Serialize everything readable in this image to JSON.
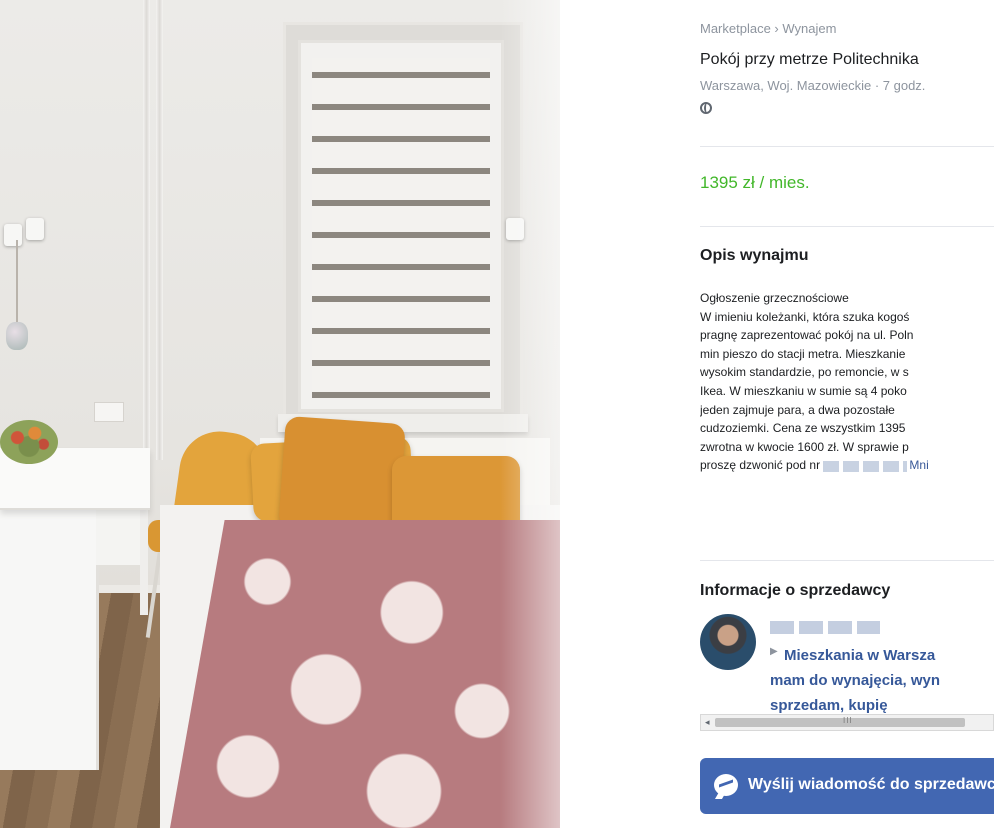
{
  "listing": {
    "breadcrumb": "Marketplace › Wynajem",
    "title": "Pokój przy metrze Politechnika",
    "location": "Warszawa, Woj. Mazowieckie · 7 godz.",
    "price": "1395 zł / mies."
  },
  "description": {
    "heading": "Opis wynajmu",
    "lines": [
      "Ogłoszenie grzecznościowe",
      "W imieniu koleżanki, która szuka kogoś",
      "pragnę zaprezentować pokój na ul. Poln",
      "min pieszo do stacji metra. Mieszkanie",
      "wysokim standardzie, po remoncie, w s",
      "Ikea. W mieszkaniu w sumie są 4 poko",
      "jeden zajmuje para, a dwa pozostałe",
      "cudzoziemki. Cena ze wszystkim 1395",
      "zwrotna w kwocie 1600 zł. W sprawie p"
    ],
    "phone_prefix": "proszę dzwonić pod nr",
    "more_link": "Mni"
  },
  "seller": {
    "heading": "Informacje o sprzedawcy",
    "group_line_1": "Mieszkania w Warsza",
    "group_line_2": "mam do wynajęcia, wyn",
    "group_line_3": "sprzedam, kupię"
  },
  "scrollbar": {
    "left_arrow": "◂",
    "grip": "III"
  },
  "actions": {
    "message_button": "Wyślij wiadomość do sprzedawcy"
  },
  "icons": {
    "location": "globe-icon",
    "messenger": "messenger-icon",
    "group_arrow": "triangle-right-icon"
  },
  "colors": {
    "price": "#42b72a",
    "primary_button": "#4267b2",
    "link": "#365899",
    "muted_text": "#8d949e"
  }
}
